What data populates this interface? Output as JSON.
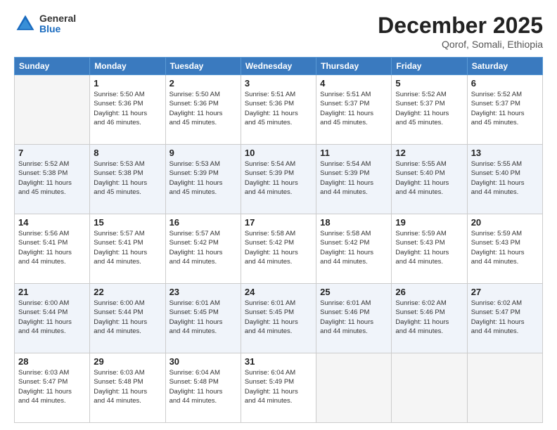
{
  "logo": {
    "general": "General",
    "blue": "Blue"
  },
  "header": {
    "title": "December 2025",
    "subtitle": "Qorof, Somali, Ethiopia"
  },
  "days_of_week": [
    "Sunday",
    "Monday",
    "Tuesday",
    "Wednesday",
    "Thursday",
    "Friday",
    "Saturday"
  ],
  "weeks": [
    [
      {
        "day": "",
        "info": ""
      },
      {
        "day": "1",
        "info": "Sunrise: 5:50 AM\nSunset: 5:36 PM\nDaylight: 11 hours\nand 46 minutes."
      },
      {
        "day": "2",
        "info": "Sunrise: 5:50 AM\nSunset: 5:36 PM\nDaylight: 11 hours\nand 45 minutes."
      },
      {
        "day": "3",
        "info": "Sunrise: 5:51 AM\nSunset: 5:36 PM\nDaylight: 11 hours\nand 45 minutes."
      },
      {
        "day": "4",
        "info": "Sunrise: 5:51 AM\nSunset: 5:37 PM\nDaylight: 11 hours\nand 45 minutes."
      },
      {
        "day": "5",
        "info": "Sunrise: 5:52 AM\nSunset: 5:37 PM\nDaylight: 11 hours\nand 45 minutes."
      },
      {
        "day": "6",
        "info": "Sunrise: 5:52 AM\nSunset: 5:37 PM\nDaylight: 11 hours\nand 45 minutes."
      }
    ],
    [
      {
        "day": "7",
        "info": "Sunrise: 5:52 AM\nSunset: 5:38 PM\nDaylight: 11 hours\nand 45 minutes."
      },
      {
        "day": "8",
        "info": "Sunrise: 5:53 AM\nSunset: 5:38 PM\nDaylight: 11 hours\nand 45 minutes."
      },
      {
        "day": "9",
        "info": "Sunrise: 5:53 AM\nSunset: 5:39 PM\nDaylight: 11 hours\nand 45 minutes."
      },
      {
        "day": "10",
        "info": "Sunrise: 5:54 AM\nSunset: 5:39 PM\nDaylight: 11 hours\nand 44 minutes."
      },
      {
        "day": "11",
        "info": "Sunrise: 5:54 AM\nSunset: 5:39 PM\nDaylight: 11 hours\nand 44 minutes."
      },
      {
        "day": "12",
        "info": "Sunrise: 5:55 AM\nSunset: 5:40 PM\nDaylight: 11 hours\nand 44 minutes."
      },
      {
        "day": "13",
        "info": "Sunrise: 5:55 AM\nSunset: 5:40 PM\nDaylight: 11 hours\nand 44 minutes."
      }
    ],
    [
      {
        "day": "14",
        "info": "Sunrise: 5:56 AM\nSunset: 5:41 PM\nDaylight: 11 hours\nand 44 minutes."
      },
      {
        "day": "15",
        "info": "Sunrise: 5:57 AM\nSunset: 5:41 PM\nDaylight: 11 hours\nand 44 minutes."
      },
      {
        "day": "16",
        "info": "Sunrise: 5:57 AM\nSunset: 5:42 PM\nDaylight: 11 hours\nand 44 minutes."
      },
      {
        "day": "17",
        "info": "Sunrise: 5:58 AM\nSunset: 5:42 PM\nDaylight: 11 hours\nand 44 minutes."
      },
      {
        "day": "18",
        "info": "Sunrise: 5:58 AM\nSunset: 5:42 PM\nDaylight: 11 hours\nand 44 minutes."
      },
      {
        "day": "19",
        "info": "Sunrise: 5:59 AM\nSunset: 5:43 PM\nDaylight: 11 hours\nand 44 minutes."
      },
      {
        "day": "20",
        "info": "Sunrise: 5:59 AM\nSunset: 5:43 PM\nDaylight: 11 hours\nand 44 minutes."
      }
    ],
    [
      {
        "day": "21",
        "info": "Sunrise: 6:00 AM\nSunset: 5:44 PM\nDaylight: 11 hours\nand 44 minutes."
      },
      {
        "day": "22",
        "info": "Sunrise: 6:00 AM\nSunset: 5:44 PM\nDaylight: 11 hours\nand 44 minutes."
      },
      {
        "day": "23",
        "info": "Sunrise: 6:01 AM\nSunset: 5:45 PM\nDaylight: 11 hours\nand 44 minutes."
      },
      {
        "day": "24",
        "info": "Sunrise: 6:01 AM\nSunset: 5:45 PM\nDaylight: 11 hours\nand 44 minutes."
      },
      {
        "day": "25",
        "info": "Sunrise: 6:01 AM\nSunset: 5:46 PM\nDaylight: 11 hours\nand 44 minutes."
      },
      {
        "day": "26",
        "info": "Sunrise: 6:02 AM\nSunset: 5:46 PM\nDaylight: 11 hours\nand 44 minutes."
      },
      {
        "day": "27",
        "info": "Sunrise: 6:02 AM\nSunset: 5:47 PM\nDaylight: 11 hours\nand 44 minutes."
      }
    ],
    [
      {
        "day": "28",
        "info": "Sunrise: 6:03 AM\nSunset: 5:47 PM\nDaylight: 11 hours\nand 44 minutes."
      },
      {
        "day": "29",
        "info": "Sunrise: 6:03 AM\nSunset: 5:48 PM\nDaylight: 11 hours\nand 44 minutes."
      },
      {
        "day": "30",
        "info": "Sunrise: 6:04 AM\nSunset: 5:48 PM\nDaylight: 11 hours\nand 44 minutes."
      },
      {
        "day": "31",
        "info": "Sunrise: 6:04 AM\nSunset: 5:49 PM\nDaylight: 11 hours\nand 44 minutes."
      },
      {
        "day": "",
        "info": ""
      },
      {
        "day": "",
        "info": ""
      },
      {
        "day": "",
        "info": ""
      }
    ]
  ]
}
